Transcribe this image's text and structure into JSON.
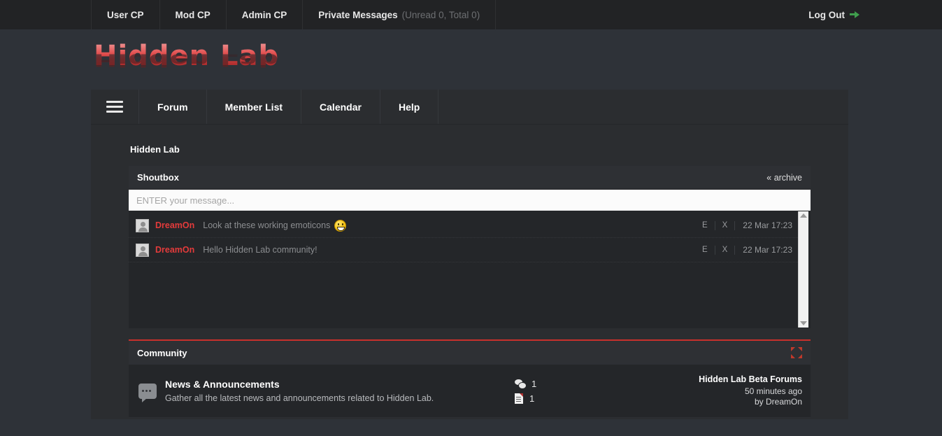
{
  "topbar": {
    "items": [
      {
        "label": "User CP"
      },
      {
        "label": "Mod CP"
      },
      {
        "label": "Admin CP"
      },
      {
        "label": "Private Messages",
        "muted": "(Unread 0, Total 0)"
      }
    ],
    "logout_label": "Log Out"
  },
  "logo": {
    "text": "Hidden Lab"
  },
  "nav": {
    "items": [
      {
        "label": "Forum"
      },
      {
        "label": "Member List"
      },
      {
        "label": "Calendar"
      },
      {
        "label": "Help"
      }
    ]
  },
  "breadcrumb": {
    "text": "Hidden Lab"
  },
  "shoutbox": {
    "title": "Shoutbox",
    "archive_label": "« archive",
    "input_placeholder": "ENTER your message...",
    "input_value": "",
    "shouts": [
      {
        "user": "DreamOn",
        "message": "Look at these working emoticons",
        "has_emoticon": true,
        "edit_label": "E",
        "delete_label": "X",
        "time": "22 Mar 17:23"
      },
      {
        "user": "DreamOn",
        "message": "Hello Hidden Lab community!",
        "has_emoticon": false,
        "edit_label": "E",
        "delete_label": "X",
        "time": "22 Mar 17:23"
      }
    ]
  },
  "community": {
    "title": "Community",
    "accent_color": "#c9302c",
    "forums": [
      {
        "name": "News & Announcements",
        "description": "Gather all the latest news and announcements related to Hidden Lab.",
        "replies": "1",
        "threads": "1",
        "last_post_title": "Hidden Lab Beta Forums",
        "last_post_time": "50 minutes ago",
        "last_post_author": "by DreamOn"
      }
    ]
  }
}
